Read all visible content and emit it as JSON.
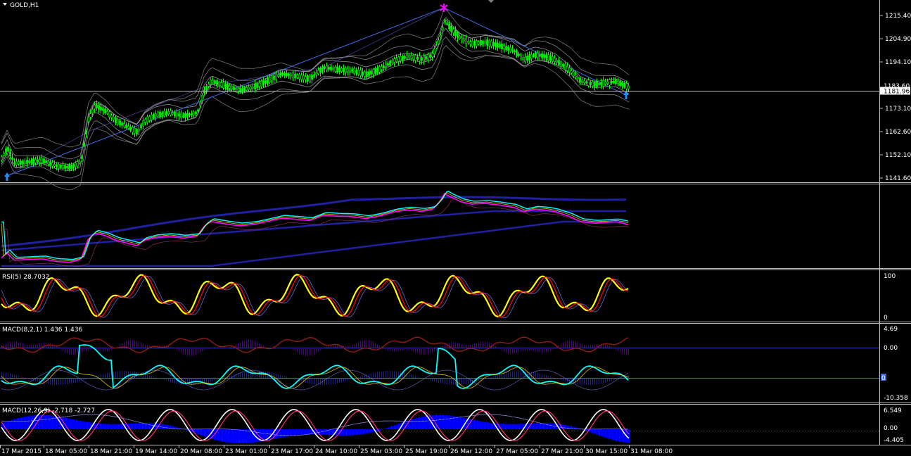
{
  "window": {
    "title": "GOLD,H1"
  },
  "colors": {
    "background": "#000000",
    "candle_up": "#00ff00",
    "candle_wick": "#00ff00",
    "bands": "#c0c0c0",
    "zigzag": "#4169e1",
    "arrow_up": "#1e90ff",
    "arrow_top": "#ff00ff",
    "rsi_main": "#ffff00",
    "rsi_signal": "#ff0000",
    "macd_hist": "#0000ff",
    "macd_cyan": "#00ffff",
    "macd_white": "#ffffff",
    "price_line": "#c0c0c0"
  },
  "main": {
    "price_levels": [
      "1215.40",
      "1204.90",
      "1194.10",
      "1173.10",
      "1162.60",
      "1152.10",
      "1141.60"
    ],
    "current_price": "1181.96",
    "hidden_price": "1183.60",
    "icons": {
      "top": "asterisk-icon",
      "bottom": "arrow-up-icon"
    }
  },
  "indicators": [
    {
      "id": "ma-panel",
      "title": ""
    },
    {
      "id": "rsi",
      "title": "RSI(5) 28.7032",
      "levels": [
        "100",
        "0"
      ]
    },
    {
      "id": "macd1",
      "title": "MACD(8,2,1) 1.436 1.436",
      "levels": [
        "4.69",
        "0.00",
        "0",
        "-10.358"
      ]
    },
    {
      "id": "macd2",
      "title": "MACD(12,26,9) -2.718 -2.727",
      "levels": [
        "6.549",
        "0.00",
        "-4.405"
      ]
    }
  ],
  "time_axis": [
    "17 Mar 2015",
    "18 Mar 05:00",
    "18 Mar 21:00",
    "19 Mar 14:00",
    "20 Mar 08:00",
    "23 Mar 01:00",
    "23 Mar 17:00",
    "24 Mar 10:00",
    "25 Mar 03:00",
    "25 Mar 19:00",
    "26 Mar 12:00",
    "27 Mar 05:00",
    "27 Mar 21:00",
    "30 Mar 15:00",
    "31 Mar 08:00"
  ]
}
